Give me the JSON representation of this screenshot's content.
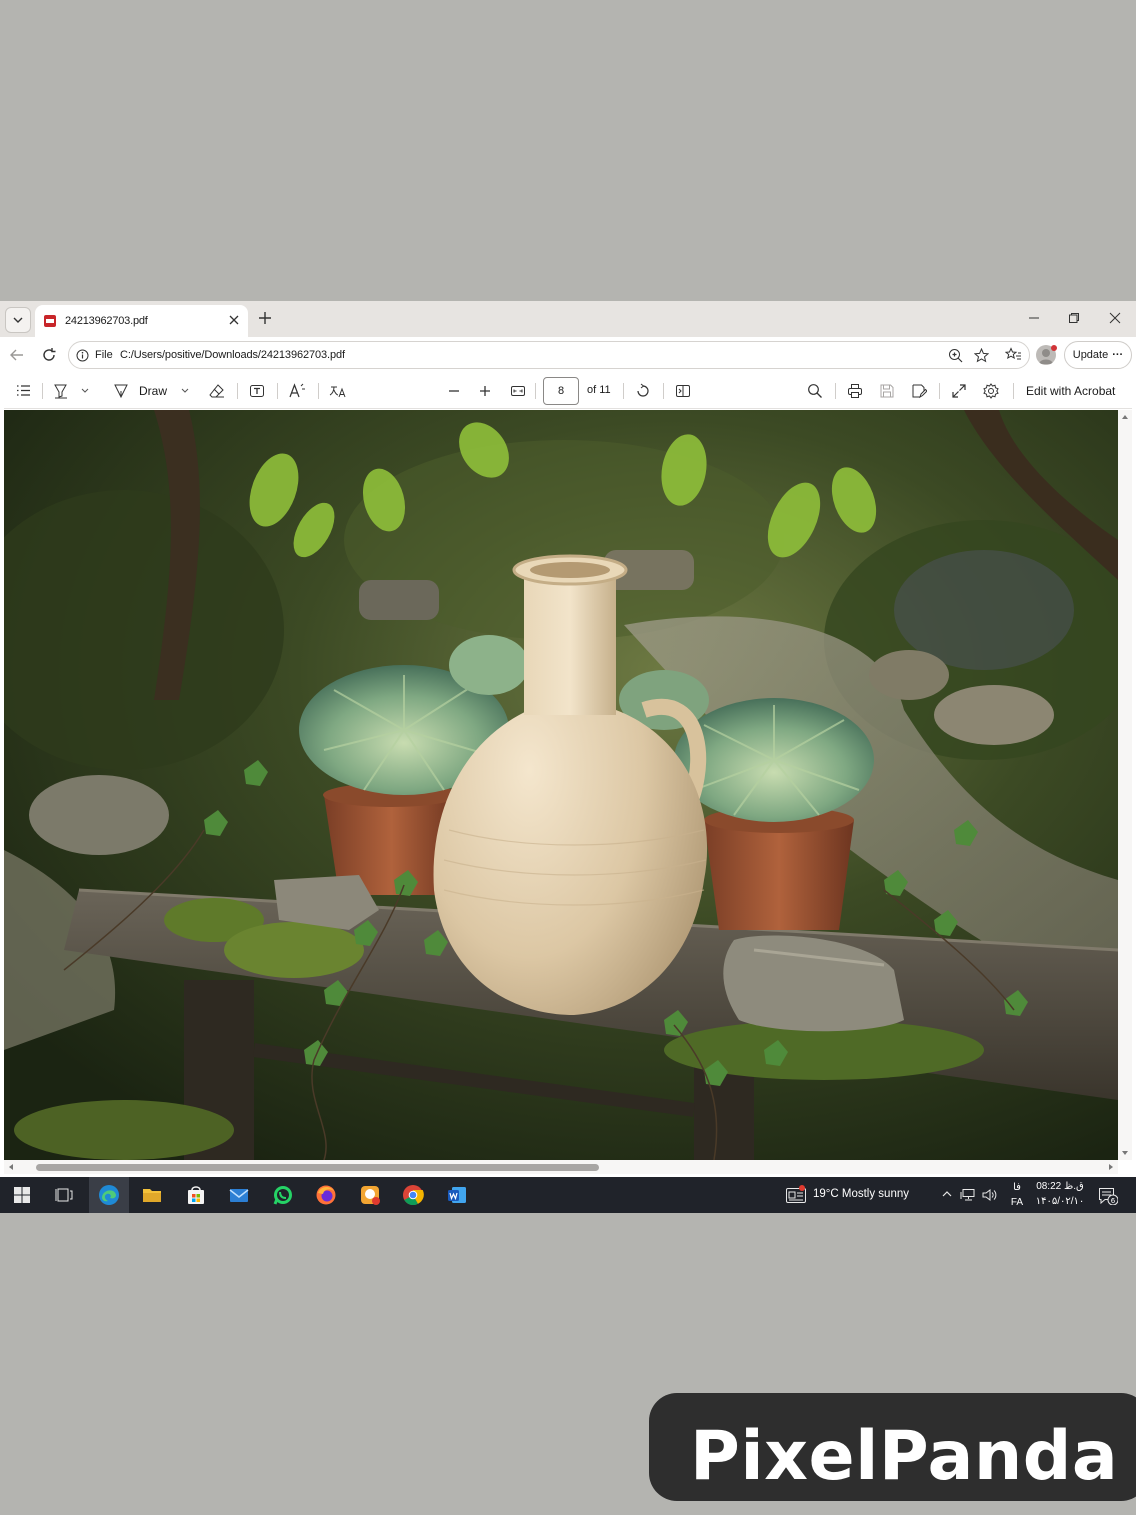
{
  "browser": {
    "tab_title": "24213962703.pdf",
    "address_prefix": "File",
    "address_url": "C:/Users/positive/Downloads/24213962703.pdf",
    "update_label": "Update",
    "update_more": "···"
  },
  "pdf_toolbar": {
    "draw_label": "Draw",
    "page_current": "8",
    "page_total_label": "of 11",
    "edit_acrobat_label": "Edit with Acrobat"
  },
  "document": {
    "page_image": "garden still life: cream clay jug with handle, two potted succulents in terracotta pots, ivy and moss on a weathered wooden bench, stone path background",
    "icons": [
      "contents-icon",
      "highlight-icon",
      "draw-icon",
      "eraser-icon",
      "text-box-icon",
      "read-aloud-icon",
      "translate-icon",
      "zoom-out-icon",
      "zoom-in-icon",
      "fit-page-icon",
      "rotate-icon",
      "page-view-icon",
      "search-icon",
      "print-icon",
      "save-icon",
      "save-as-icon",
      "fullscreen-icon",
      "settings-icon"
    ]
  },
  "taskbar": {
    "weather_text": "19°C  Mostly sunny",
    "lang_top": "فا",
    "lang_bottom": "FA",
    "clock_time": "ق.ظ 08:22",
    "clock_date": "۱۴۰۵/۰۲/۱۰",
    "notification_count": "6",
    "apps": [
      "windows-start",
      "task-view",
      "edge",
      "file-explorer",
      "microsoft-store",
      "mail",
      "whatsapp",
      "firefox",
      "app-badge",
      "chrome",
      "word"
    ],
    "colors": {
      "taskbar_bg": "#20232a",
      "accent": "#7bb4e6"
    }
  },
  "watermark": {
    "text": "PixelPanda"
  }
}
